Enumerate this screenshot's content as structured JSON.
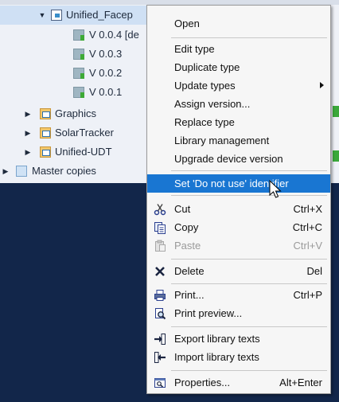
{
  "tree": {
    "rows": [
      {
        "label": "Unified_Facep",
        "expanded": true
      },
      {
        "label": "V 0.0.4 [de"
      },
      {
        "label": "V 0.0.3"
      },
      {
        "label": "V 0.0.2"
      },
      {
        "label": "V 0.0.1"
      },
      {
        "label": "Graphics"
      },
      {
        "label": "SolarTracker"
      },
      {
        "label": "Unified-UDT"
      },
      {
        "label": "Master copies"
      }
    ]
  },
  "menu": {
    "open": "Open",
    "edit_type": "Edit type",
    "duplicate_type": "Duplicate type",
    "update_types": "Update types",
    "assign_version": "Assign version...",
    "replace_type": "Replace type",
    "library_management": "Library management",
    "upgrade_device_version": "Upgrade device version",
    "set_do_not_use": "Set 'Do not use' identifier",
    "cut": "Cut",
    "cut_shortcut": "Ctrl+X",
    "copy": "Copy",
    "copy_shortcut": "Ctrl+C",
    "paste": "Paste",
    "paste_shortcut": "Ctrl+V",
    "delete": "Delete",
    "delete_shortcut": "Del",
    "print": "Print...",
    "print_shortcut": "Ctrl+P",
    "print_preview": "Print preview...",
    "export_library_texts": "Export library texts",
    "import_library_texts": "Import library texts",
    "properties": "Properties...",
    "properties_shortcut": "Alt+Enter"
  },
  "colors": {
    "highlight": "#1976d2",
    "background": "#12264a"
  }
}
